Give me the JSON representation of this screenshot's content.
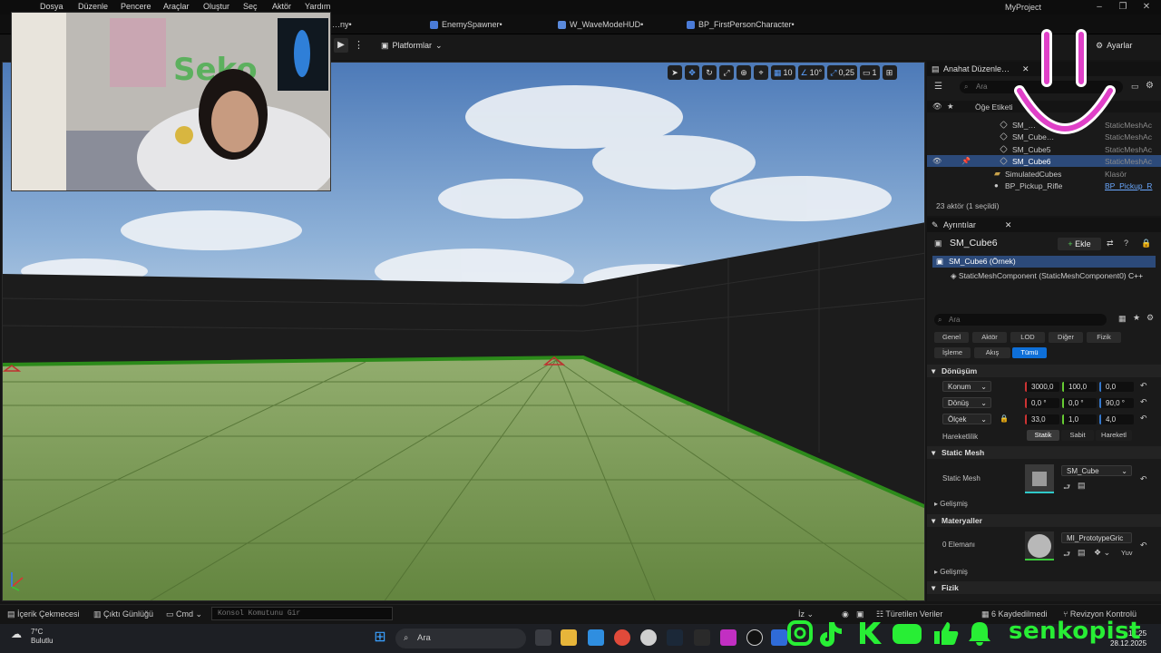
{
  "menu": {
    "items": [
      "Dosya",
      "Düzenle",
      "Pencere",
      "Araçlar",
      "Oluştur",
      "Seç",
      "Aktör",
      "Yardım"
    ]
  },
  "window": {
    "project_name": "MyProject"
  },
  "tabs": [
    {
      "label": "…ny•"
    },
    {
      "label": "EnemySpawner•"
    },
    {
      "label": "W_WaveModeHUD•"
    },
    {
      "label": "BP_FirstPersonCharacter•"
    }
  ],
  "toolbar": {
    "platforms_label": "Platformlar",
    "settings_label": "Ayarlar"
  },
  "viewport": {
    "grid_snap": "10",
    "rotation_snap": "10°",
    "scale_snap": "0,25",
    "camera_speed": "1"
  },
  "outliner": {
    "title": "Anahat Düzenle…",
    "search_placeholder": "Ara",
    "column_label": "Öğe Etiketi",
    "rows": [
      {
        "name": "SM_…",
        "type": "StaticMeshAc"
      },
      {
        "name": "SM_Cube…",
        "type": "StaticMeshAc"
      },
      {
        "name": "SM_Cube5",
        "type": "StaticMeshAc"
      },
      {
        "name": "SM_Cube6",
        "type": "StaticMeshAc"
      },
      {
        "name": "SimulatedCubes",
        "type": "Klasör"
      },
      {
        "name": "BP_Pickup_Rifle",
        "type": "BP_Pickup_R"
      }
    ],
    "footer": "23 aktör (1 seçildi)"
  },
  "details": {
    "title": "Ayrıntılar",
    "actor_name": "SM_Cube6",
    "add_label": "Ekle",
    "instance_label": "SM_Cube6 (Örnek)",
    "component_label": "StaticMeshComponent (StaticMeshComponent0)",
    "component_suffix": "C++",
    "search_placeholder": "Ara",
    "filters_row1": [
      "Genel",
      "Aktör",
      "LOD",
      "Diğer",
      "Fizik"
    ],
    "filters_row2": [
      "İşleme",
      "Akış",
      "Tümü"
    ],
    "transform_section": "Dönüşüm",
    "location_label": "Konum",
    "rotation_label": "Dönüş",
    "scale_label": "Ölçek",
    "location": [
      "3000,0",
      "100,0",
      "0,0"
    ],
    "rotation": [
      "0,0 °",
      "0,0 °",
      "90,0 °"
    ],
    "scale": [
      "33,0",
      "1,0",
      "4,0"
    ],
    "mobility_label": "Hareketlilik",
    "mobility_options": [
      "Statik",
      "Sabit",
      "Hareketl"
    ],
    "static_mesh_section": "Static Mesh",
    "static_mesh_label": "Static Mesh",
    "static_mesh_value": "SM_Cube",
    "advanced_label": "Gelişmiş",
    "materials_section": "Materyaller",
    "element_label": "0 Elemanı",
    "material_value": "MI_PrototypeGric",
    "material_extra": "Yuv",
    "advanced_label_2": "Gelişmiş",
    "physics_section": "Fizik"
  },
  "statusbar": {
    "content_drawer": "İçerik Çekmecesi",
    "output_log": "Çıktı Günlüğü",
    "cmd": "Cmd",
    "console_placeholder": "Konsol Komutunu Gir",
    "derived_data": "Türetilen Veriler",
    "saved": "6 Kaydedilmedi",
    "revision": "Revizyon Kontrolü",
    "trace_label": "İz"
  },
  "taskbar": {
    "temperature": "7°C",
    "weather": "Bulutlu",
    "search_label": "Ara",
    "time": "12:25",
    "date": "28.12.2025"
  },
  "overlay": {
    "channel_name": "senkopist"
  },
  "colors": {
    "accent": "#0e6fd8",
    "selection": "#2c4a7a",
    "overlay_green": "#28ee35",
    "smiley_pink": "#e040c8"
  }
}
